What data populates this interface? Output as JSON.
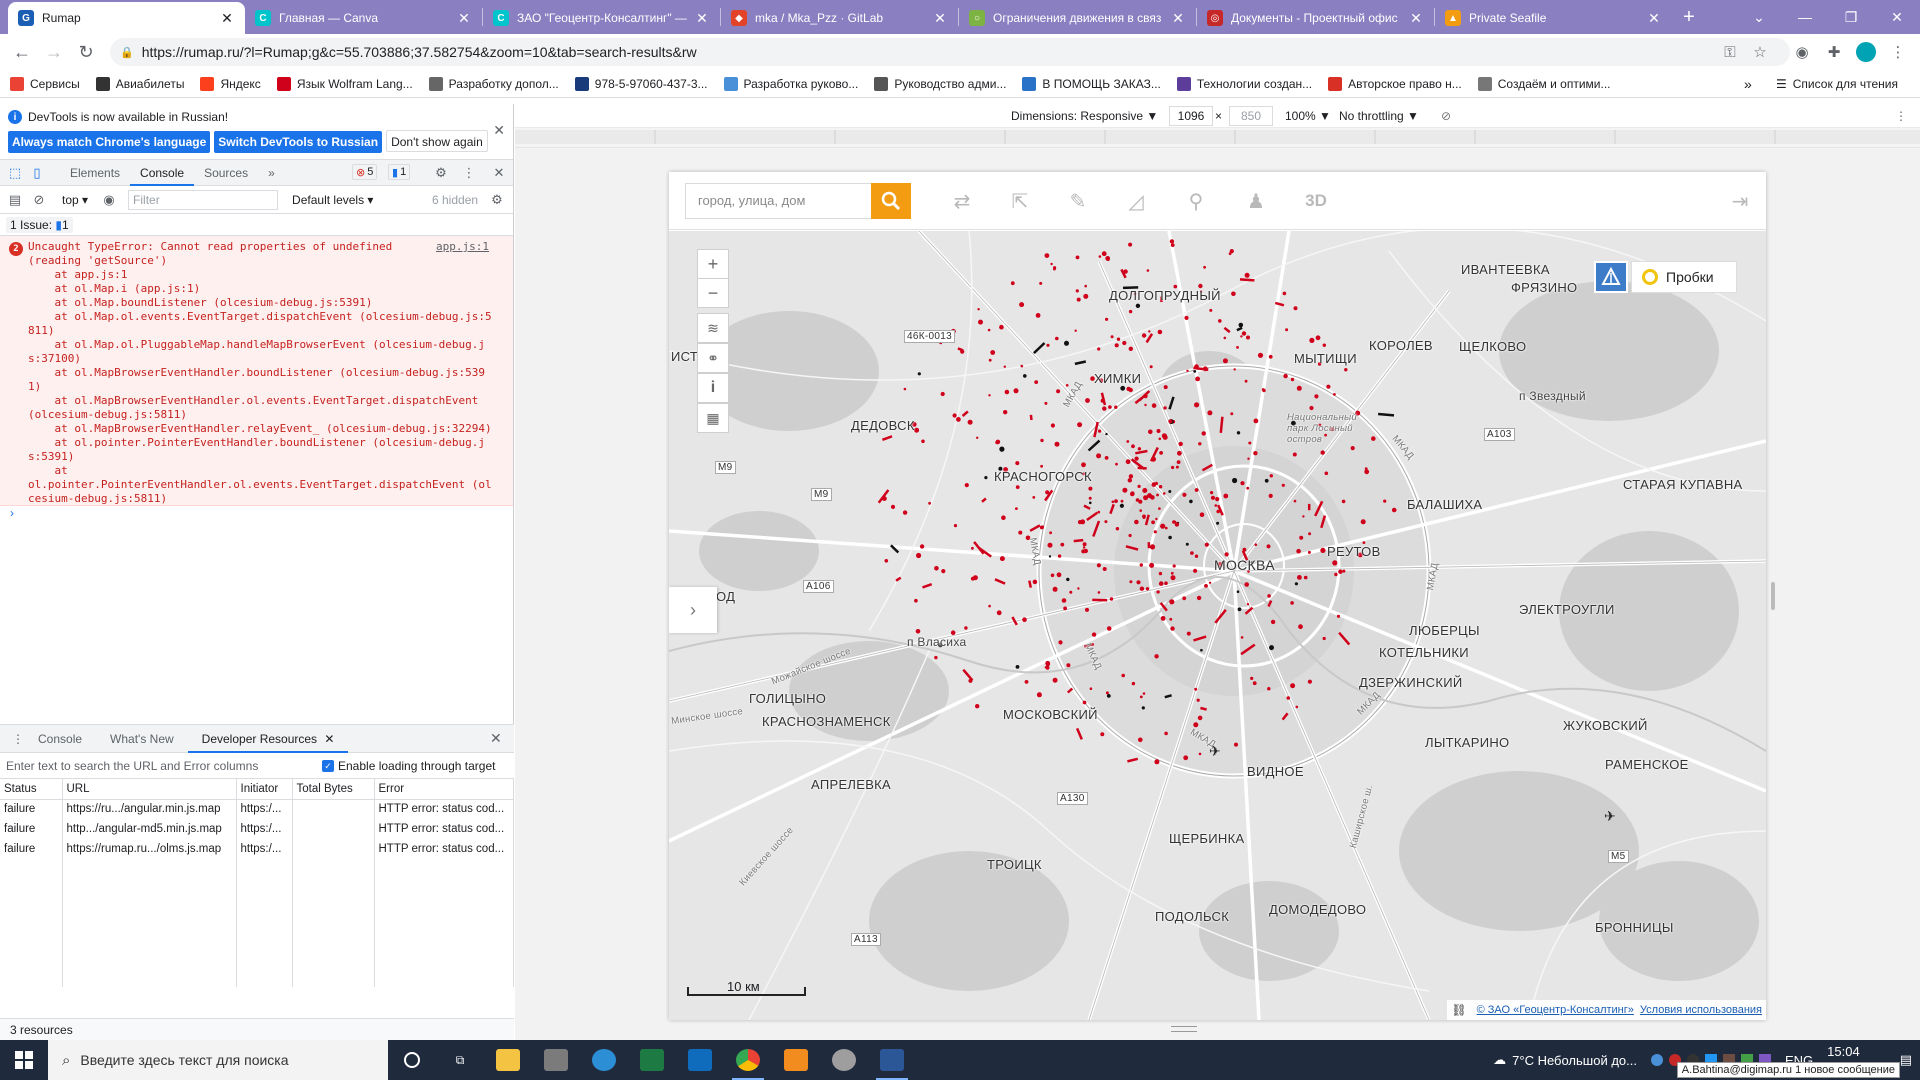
{
  "browser": {
    "tabs": [
      {
        "title": "Rumap",
        "color": "#1a5fb4",
        "glyph": "G",
        "active": true
      },
      {
        "title": "Главная — Canva",
        "color": "#00c4cc",
        "glyph": "C"
      },
      {
        "title": "ЗАО \"Геоцентр-Консалтинг\" —",
        "color": "#00c4cc",
        "glyph": "C"
      },
      {
        "title": "mka / Mka_Pzz · GitLab",
        "color": "#e24329",
        "glyph": "◆"
      },
      {
        "title": "Ограничения движения в связ",
        "color": "#7cb342",
        "glyph": "○"
      },
      {
        "title": "Документы - Проектный офис",
        "color": "#c62828",
        "glyph": "◎"
      },
      {
        "title": "Private Seafile",
        "color": "#f39c12",
        "glyph": "▲"
      }
    ],
    "url": "https://rumap.ru/?l=Rumap;g&c=55.703886;37.582754&zoom=10&tab=search-results&rw",
    "bookmarks": [
      {
        "label": "Сервисы",
        "color": "#ea4335"
      },
      {
        "label": "Авиабилеты",
        "color": "#333"
      },
      {
        "label": "Яндекс",
        "color": "#fc3f1d"
      },
      {
        "label": "Язык Wolfram Lang...",
        "color": "#d0021b"
      },
      {
        "label": "Разработку допол...",
        "color": "#666"
      },
      {
        "label": "978-5-97060-437-3...",
        "color": "#1a3b7a"
      },
      {
        "label": "Разработка руково...",
        "color": "#4a90d9"
      },
      {
        "label": "Руководство адми...",
        "color": "#555"
      },
      {
        "label": "В ПОМОЩЬ ЗАКАЗ...",
        "color": "#2a72c8"
      },
      {
        "label": "Технологии создан...",
        "color": "#5c3d99"
      },
      {
        "label": "Авторское право н...",
        "color": "#d93025"
      },
      {
        "label": "Создаём и оптими...",
        "color": "#777"
      }
    ],
    "bookmarks_more": "»",
    "reading_list": "Список для чтения"
  },
  "devtools": {
    "infobar": {
      "message": "DevTools is now available in Russian!",
      "btn_match": "Always match Chrome's language",
      "btn_switch": "Switch DevTools to Russian",
      "btn_dismiss": "Don't show again"
    },
    "tabs": {
      "elements": "Elements",
      "console": "Console",
      "sources": "Sources",
      "more": "»"
    },
    "errors_count": "5",
    "messages_count": "1",
    "console_toolbar": {
      "context": "top",
      "filter_placeholder": "Filter",
      "levels": "Default levels",
      "hidden": "6 hidden"
    },
    "issues": {
      "label": "1 Issue:",
      "count": "1"
    },
    "error": {
      "source": "app.js:1",
      "lines": [
        "Uncaught TypeError: Cannot read properties of undefined",
        "(reading 'getSource')",
        "    at app.js:1",
        "    at ol.Map.i (app.js:1)",
        "    at ol.Map.boundListener (olcesium-debug.js:5391)",
        "    at ol.Map.ol.events.EventTarget.dispatchEvent (olcesium-debug.js:5",
        "811)",
        "    at ol.Map.ol.PluggableMap.handleMapBrowserEvent (olcesium-debug.j",
        "s:37100)",
        "    at ol.MapBrowserEventHandler.boundListener (olcesium-debug.js:539",
        "1)",
        "    at ol.MapBrowserEventHandler.ol.events.EventTarget.dispatchEvent",
        "(olcesium-debug.js:5811)",
        "    at ol.MapBrowserEventHandler.relayEvent_ (olcesium-debug.js:32294)",
        "    at ol.pointer.PointerEventHandler.boundListener (olcesium-debug.j",
        "s:5391)",
        "    at",
        "ol.pointer.PointerEventHandler.ol.events.EventTarget.dispatchEvent (ol",
        "cesium-debug.js:5811)"
      ]
    },
    "prompt": "›",
    "drawer": {
      "tabs": [
        "Console",
        "What's New",
        "Developer Resources"
      ],
      "filter_placeholder": "Enter text to search the URL and Error columns",
      "checkbox_label": "Enable loading through target",
      "columns": [
        "Status",
        "URL",
        "Initiator",
        "Total Bytes",
        "Error"
      ],
      "rows": [
        {
          "status": "failure",
          "url": "https://ru.../angular.min.js.map",
          "initiator": "https:/...",
          "bytes": "",
          "error": "HTTP error: status cod..."
        },
        {
          "status": "failure",
          "url": "http.../angular-md5.min.js.map",
          "initiator": "https:/...",
          "bytes": "",
          "error": "HTTP error: status cod..."
        },
        {
          "status": "failure",
          "url": "https://rumap.ru.../olms.js.map",
          "initiator": "https:/...",
          "bytes": "",
          "error": "HTTP error: status cod..."
        }
      ],
      "footer": "3 resources"
    }
  },
  "device_toolbar": {
    "dimensions_label": "Dimensions: Responsive ▼",
    "width": "1096",
    "times": "×",
    "height": "850",
    "zoom": "100% ▼",
    "throttling": "No throttling ▼"
  },
  "rumap": {
    "search_placeholder": "город, улица, дом",
    "traffic_label": "Пробки",
    "labels": {
      "ivanteevka": "ИВАНТЕЕВКА",
      "fryazino": "ФРЯЗИНО",
      "dolgoprudny": "ДОЛГОПРУДНЫЙ",
      "mytishchi": "МЫТИЩИ",
      "korolev": "КОРОЛЕВ",
      "shchelkovo": "ЩЕЛКОВО",
      "khimki": "ХИМКИ",
      "dedovsk": "ДЕДОВСК",
      "krasnogorsk": "КРАСНОГОРСК",
      "balashikha": "БАЛАШИХА",
      "staraya_kupavna": "СТАРАЯ КУПАВНА",
      "reutov": "РЕУТОВ",
      "moskva": "МОСКВА",
      "elektrougli": "ЭЛЕКТРОУГЛИ",
      "lyubertsy": "ЛЮБЕРЦЫ",
      "kotelniki": "КОТЕЛЬНИКИ",
      "dzerzhinsky": "ДЗЕРЖИНСКИЙ",
      "golitsyno": "ГОЛИЦЫНО",
      "krasnoznamensk": "КРАСНОЗНАМЕНСК",
      "moskovsky": "МОСКОВСКИЙ",
      "vidnoe": "ВИДНОЕ",
      "zhukovsky": "ЖУКОВСКИЙ",
      "lytkarino": "ЛЫТКАРИНО",
      "ramenskoe": "РАМЕНСКОЕ",
      "aprelevka": "АПРЕЛЕВКА",
      "shcherbinka": "ЩЕРБИНКА",
      "troitsk": "ТРОИЦК",
      "podolsk": "ПОДОЛЬСК",
      "domodedovo": "ДОМОДЕДОВО",
      "bronnitsy": "БРОННИЦЫ",
      "istra": "ИСТРА",
      "nigorod": "НИГОРОД",
      "vlasikha": "п Власиха",
      "mkad": "МКАД",
      "a103": "A103",
      "a106": "A106",
      "a130": "A130",
      "a113": "A113",
      "m9a": "M9",
      "m9b": "M9",
      "m5": "M5",
      "r46k": "46К-0013",
      "zvezdny": "п Звездный",
      "mozhaiskoe": "Можайское шоссе",
      "minskoe": "Минское шоссе",
      "kievskoe": "Киевское шоссе",
      "kashirskoe": "Каширское ш.",
      "park": "Национальный парк Лосиный остров"
    },
    "scale_label": "10 км",
    "attribution_company": "© ЗАО «Геоцентр-Консалтинг»",
    "attribution_terms": "Условия использования"
  },
  "taskbar": {
    "search_placeholder": "Введите здесь текст для поиска",
    "weather": "7°C  Небольшой до...",
    "lang": "ENG",
    "time": "15:04",
    "toast": "A.Bahtina@digimap.ru 1 новое сообщение"
  }
}
